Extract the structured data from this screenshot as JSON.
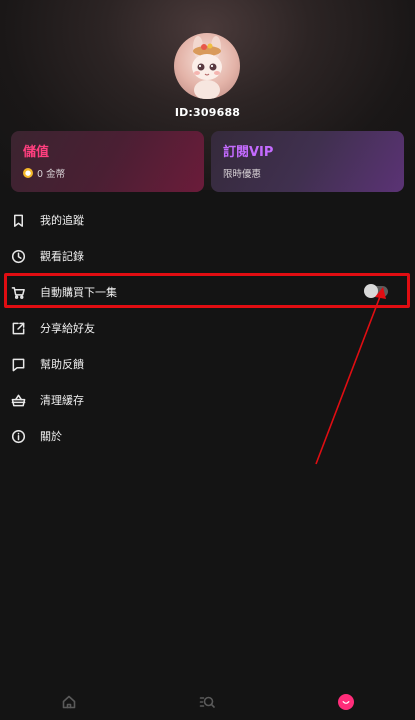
{
  "profile": {
    "user_id": "ID:309688",
    "avatar_icon": "bunny-avatar"
  },
  "cards": {
    "recharge": {
      "title": "儲值",
      "balance": "0 金幣",
      "coin_icon": "coin-icon"
    },
    "vip": {
      "title": "訂閱VIP",
      "subtitle": "限時優惠"
    }
  },
  "menu": {
    "items": [
      {
        "label": "我的追蹤",
        "icon": "bookmark-icon"
      },
      {
        "label": "觀看記錄",
        "icon": "clock-icon"
      },
      {
        "label": "自動購買下一集",
        "icon": "cart-icon"
      },
      {
        "label": "分享給好友",
        "icon": "share-icon"
      },
      {
        "label": "幫助反饋",
        "icon": "chat-icon"
      },
      {
        "label": "清理緩存",
        "icon": "basket-icon"
      },
      {
        "label": "關於",
        "icon": "info-icon"
      }
    ],
    "auto_buy_enabled": false
  },
  "bottom_nav": [
    {
      "label": "home",
      "icon": "home-icon"
    },
    {
      "label": "discover",
      "icon": "search-icon"
    },
    {
      "label": "me",
      "icon": "smile-icon",
      "active": true
    }
  ],
  "colors": {
    "accent_pink": "#ff2d7a",
    "vip_purple": "#c46bff",
    "annotation_red": "#e00d12",
    "background": "#141414"
  }
}
